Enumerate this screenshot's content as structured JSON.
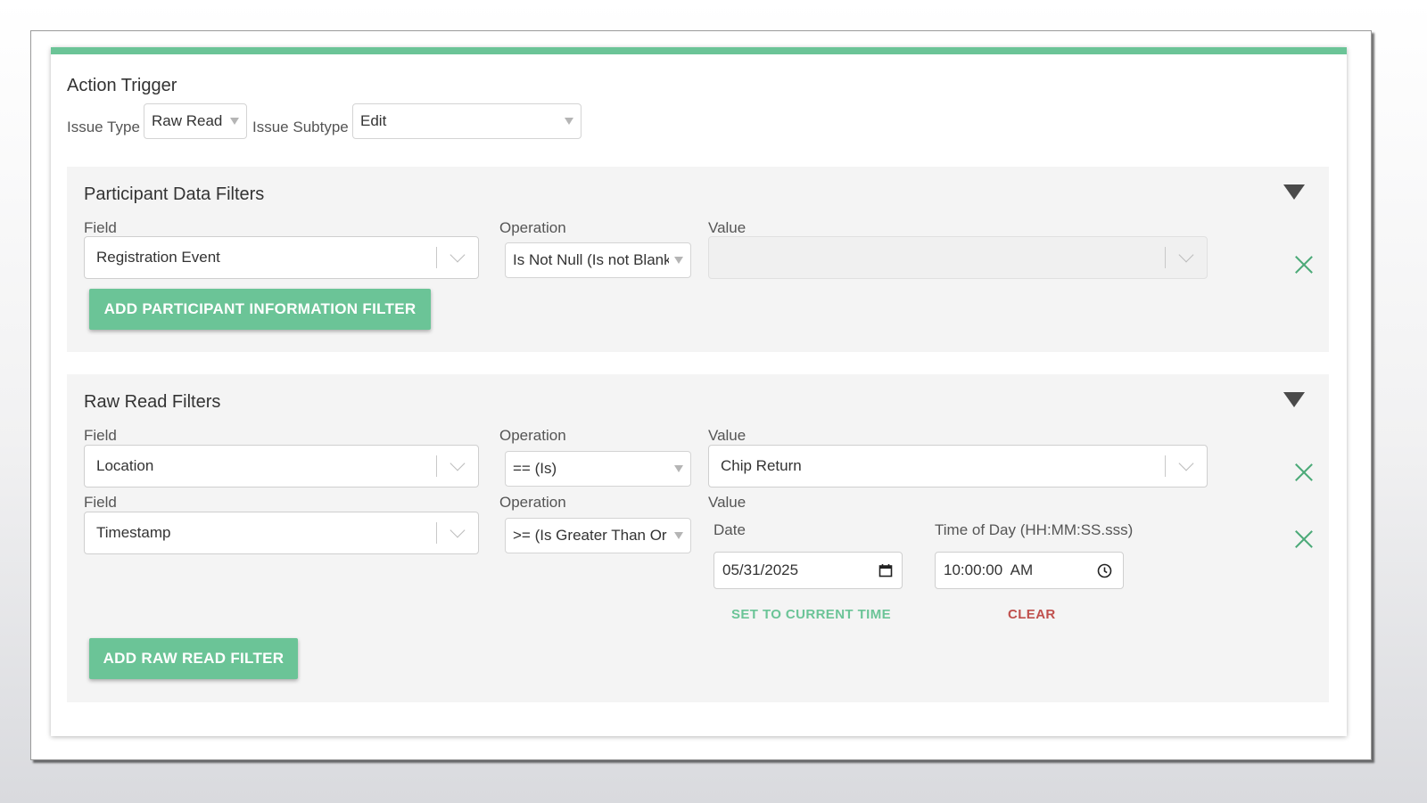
{
  "action_trigger": {
    "title": "Action Trigger",
    "issue_type_label": "Issue Type",
    "issue_type_value": "Raw Read",
    "issue_subtype_label": "Issue Subtype",
    "issue_subtype_value": "Edit"
  },
  "participant_filters": {
    "title": "Participant Data Filters",
    "field_label": "Field",
    "operation_label": "Operation",
    "value_label": "Value",
    "rows": [
      {
        "field": "Registration Event",
        "operation": "Is Not Null (Is not Blank)",
        "value": ""
      }
    ],
    "add_button": "ADD PARTICIPANT INFORMATION FILTER"
  },
  "raw_read_filters": {
    "title": "Raw Read Filters",
    "rows": [
      {
        "field_label": "Field",
        "field": "Location",
        "operation_label": "Operation",
        "operation": "== (Is)",
        "value_label": "Value",
        "value": "Chip Return"
      },
      {
        "field_label": "Field",
        "field": "Timestamp",
        "operation_label": "Operation",
        "operation": ">= (Is Greater Than Or Equal)",
        "value_label": "Value",
        "date_label": "Date",
        "date_value": "05/31/2025",
        "time_label": "Time of Day (HH:MM:SS.sss)",
        "time_value": "10:00:00  AM",
        "set_current_label": "SET TO CURRENT TIME",
        "clear_label": "CLEAR"
      }
    ],
    "add_button": "ADD RAW READ FILTER"
  },
  "colors": {
    "accent": "#6bc497",
    "clear": "#c0504d",
    "panel_bg": "#f4f4f4"
  }
}
